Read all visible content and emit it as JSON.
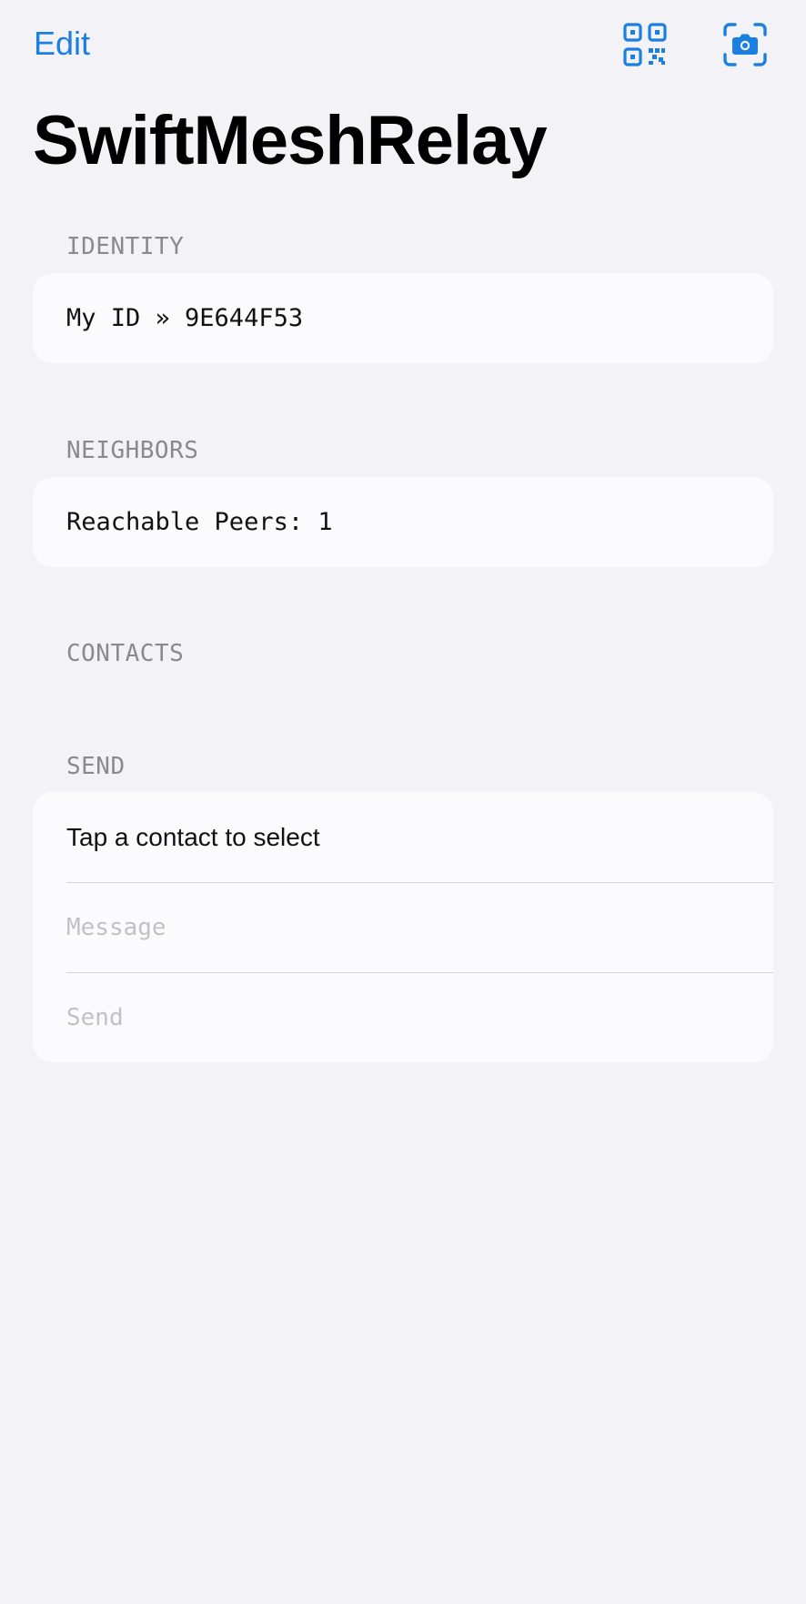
{
  "nav": {
    "edit_label": "Edit",
    "qr_icon": "qrcode-icon",
    "camera_icon": "camera-viewfinder-icon",
    "accent_color": "#1a7fe0"
  },
  "title": "SwiftMeshRelay",
  "identity": {
    "header": "IDENTITY",
    "my_id": "My ID » 9E644F53"
  },
  "neighbors": {
    "header": "NEIGHBORS",
    "reachable": "Reachable Peers: 1"
  },
  "contacts": {
    "header": "CONTACTS",
    "items": []
  },
  "send": {
    "header": "SEND",
    "contact_prompt": "Tap a contact to select",
    "message_placeholder": "Message",
    "send_label": "Send"
  }
}
